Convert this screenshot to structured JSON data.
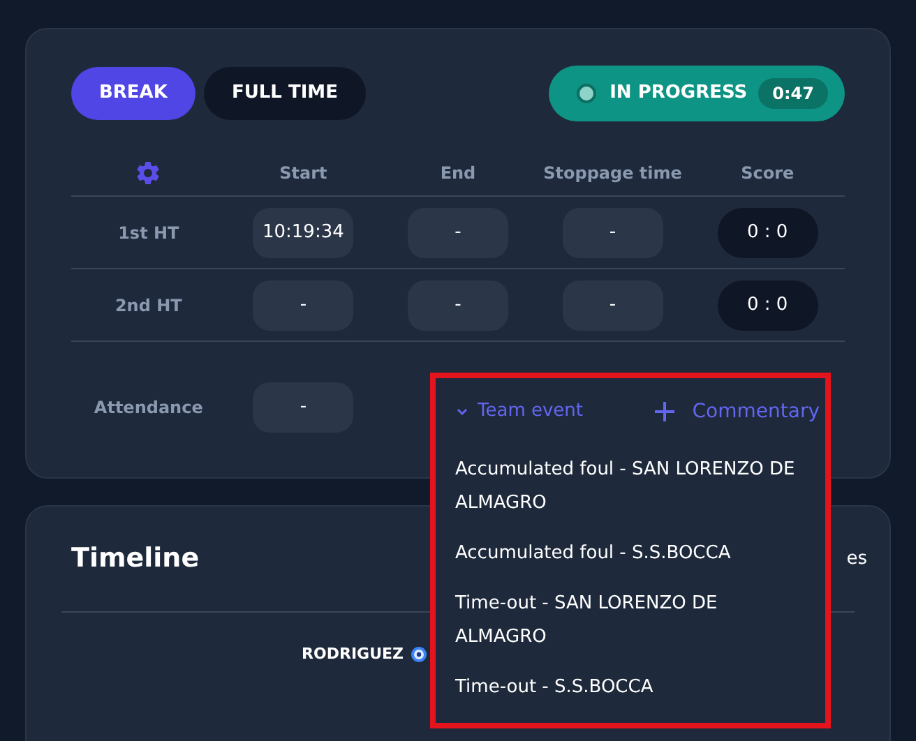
{
  "controls": {
    "buttons": [
      {
        "label": "BREAK",
        "kind": "primary"
      },
      {
        "label": "FULL TIME",
        "kind": "dark"
      }
    ],
    "status": {
      "label": "IN PROGRESS",
      "timer": "0:47"
    }
  },
  "periods": {
    "columns": [
      "Start",
      "End",
      "Stoppage time",
      "Score"
    ],
    "rows": [
      {
        "label": "1st HT",
        "start": "10:19:34",
        "end": "-",
        "stoppage": "-",
        "score": "0 : 0"
      },
      {
        "label": "2nd HT",
        "start": "-",
        "end": "-",
        "stoppage": "-",
        "score": "0 : 0"
      }
    ],
    "attendance": {
      "label": "Attendance",
      "value": "-"
    }
  },
  "event_menu": {
    "trigger": "Team event",
    "expanded": true,
    "commentary": "Commentary",
    "items": [
      "Accumulated foul - SAN LORENZO DE ALMAGRO",
      "Accumulated foul - S.S.BOCCA",
      "Time-out - SAN LORENZO DE ALMAGRO",
      "Time-out - S.S.BOCCA"
    ]
  },
  "timeline": {
    "title": "Timeline",
    "side_text": "es",
    "events": [
      {
        "player": "RODRIGUEZ"
      }
    ]
  }
}
